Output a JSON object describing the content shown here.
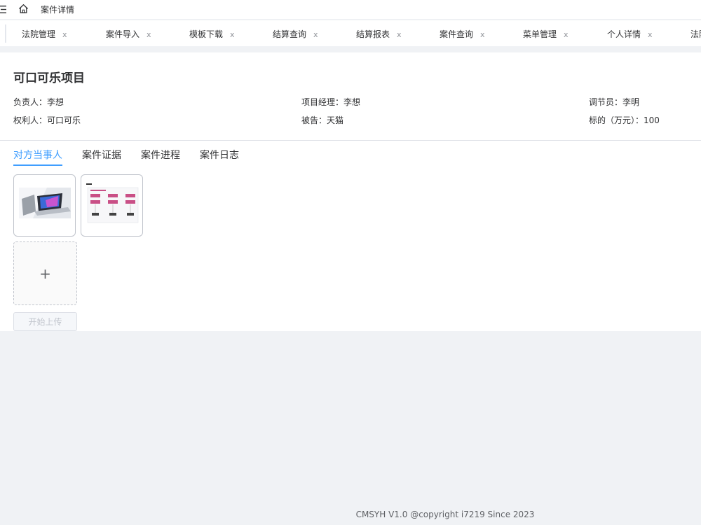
{
  "topbar": {
    "title": "案件详情",
    "menu_icon": "menu-fold-icon",
    "home_icon": "home-icon"
  },
  "tabs": [
    {
      "label": "法院管理",
      "close": "x"
    },
    {
      "label": "案件导入",
      "close": "x"
    },
    {
      "label": "模板下载",
      "close": "x"
    },
    {
      "label": "结算查询",
      "close": "x"
    },
    {
      "label": "结算报表",
      "close": "x"
    },
    {
      "label": "案件查询",
      "close": "x"
    },
    {
      "label": "菜单管理",
      "close": "x"
    },
    {
      "label": "个人详情",
      "close": "x"
    },
    {
      "label": "法院",
      "close": ""
    }
  ],
  "project": {
    "title": "可口可乐项目",
    "owner": "负责人：李想",
    "pm": "项目经理：李想",
    "mediator": "调节员：李明",
    "right_holder": "权利人：可口可乐",
    "defendant": "被告：天猫",
    "amount": "标的（万元）：100"
  },
  "sub_tabs": [
    {
      "label": "对方当事人",
      "active": true
    },
    {
      "label": "案件证据",
      "active": false
    },
    {
      "label": "案件进程",
      "active": false
    },
    {
      "label": "案件日志",
      "active": false
    }
  ],
  "upload": {
    "plus": "+",
    "button_label": "开始上传"
  },
  "footer": {
    "text": "CMSYH V1.0 @copyright i7219 Since 2023"
  },
  "colors": {
    "accent": "#409eff",
    "background": "#f0f2f5"
  }
}
